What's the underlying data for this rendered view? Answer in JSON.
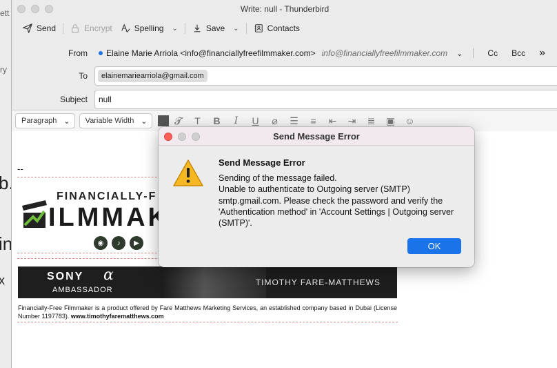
{
  "window": {
    "title": "Write: null - Thunderbird"
  },
  "toolbar": {
    "send": "Send",
    "encrypt": "Encrypt",
    "spelling": "Spelling",
    "save": "Save",
    "contacts": "Contacts"
  },
  "headers": {
    "from_label": "From",
    "from_value": "Elaine Marie Arriola <info@financiallyfreefilmmaker.com>",
    "from_alias": "info@financiallyfreefilmmaker.com",
    "cc": "Cc",
    "bcc": "Bcc",
    "more": "»",
    "to_label": "To",
    "to_recipient": "elainemariearriola@gmail.com",
    "subject_label": "Subject",
    "subject_value": "null"
  },
  "format_bar": {
    "paragraph": "Paragraph",
    "font": "Variable Width"
  },
  "body": {
    "sig_separator": "--",
    "logo_top": "FINANCIALLY-F",
    "logo_main": "ILMMAK",
    "banner_sony": "SONY",
    "banner_alpha": "α",
    "banner_ambassador": "AMBASSADOR",
    "banner_name": "TIMOTHY FARE-MATTHEWS",
    "disclaimer": "Financially-Free Filmmaker is a product offered by Fare Matthews Marketing Services, an established company based in Dubai (License Number 1197783).",
    "website": "www.timothyfarematthews.com"
  },
  "dialog": {
    "title": "Send Message Error",
    "heading": "Send Message Error",
    "message": "Sending of the message failed.\nUnable to authenticate to Outgoing server (SMTP) smtp.gmail.com. Please check the password and verify the 'Authentication method' in 'Account Settings | Outgoing server (SMTP)'.",
    "ok": "OK"
  },
  "background": {
    "frag1": "ett",
    "frag2": "ry",
    "big1": "b.",
    "big2": "in",
    "big3": "x"
  }
}
